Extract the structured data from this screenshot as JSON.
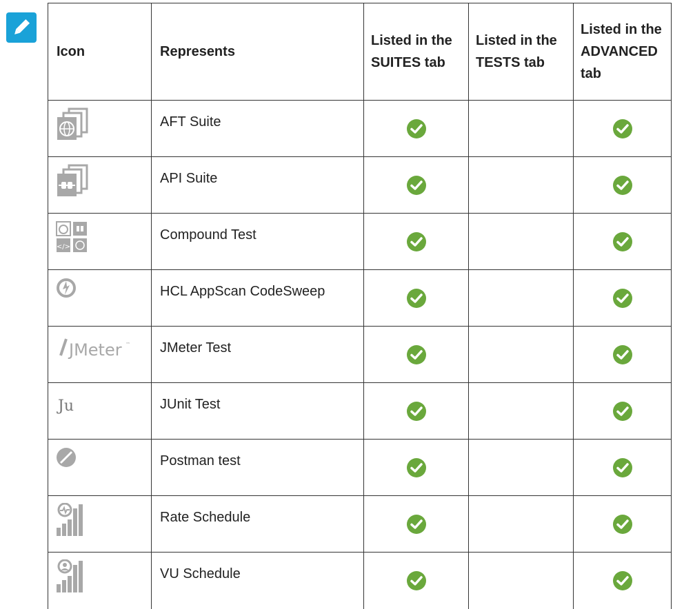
{
  "colors": {
    "note_bg": "#1aa2d8",
    "check_green": "#6aa83c",
    "icon_gray": "#a8a8a8"
  },
  "table": {
    "headers": {
      "icon": "Icon",
      "represents": "Represents",
      "suites_tab": "Listed in the SUITES tab",
      "tests_tab": "Listed in the TESTS tab",
      "advanced_tab": "Listed in the ADVANCED tab"
    },
    "rows": [
      {
        "icon": "aft-suite-icon",
        "represents": "AFT Suite",
        "suites": true,
        "tests": false,
        "advanced": true
      },
      {
        "icon": "api-suite-icon",
        "represents": "API Suite",
        "suites": true,
        "tests": false,
        "advanced": true
      },
      {
        "icon": "compound-test-icon",
        "represents": "Compound Test",
        "suites": true,
        "tests": false,
        "advanced": true
      },
      {
        "icon": "codesweep-icon",
        "represents": "HCL AppScan CodeSweep",
        "suites": true,
        "tests": false,
        "advanced": true
      },
      {
        "icon": "jmeter-logo",
        "icon_text": "JMeter",
        "represents": "JMeter Test",
        "suites": true,
        "tests": false,
        "advanced": true
      },
      {
        "icon": "junit-icon",
        "icon_text": "Ju",
        "represents": "JUnit Test",
        "suites": true,
        "tests": false,
        "advanced": true
      },
      {
        "icon": "postman-icon",
        "represents": "Postman test",
        "suites": true,
        "tests": false,
        "advanced": true
      },
      {
        "icon": "rate-schedule-icon",
        "represents": "Rate Schedule",
        "suites": true,
        "tests": false,
        "advanced": true
      },
      {
        "icon": "vu-schedule-icon",
        "represents": "VU Schedule",
        "suites": true,
        "tests": false,
        "advanced": true
      }
    ]
  }
}
